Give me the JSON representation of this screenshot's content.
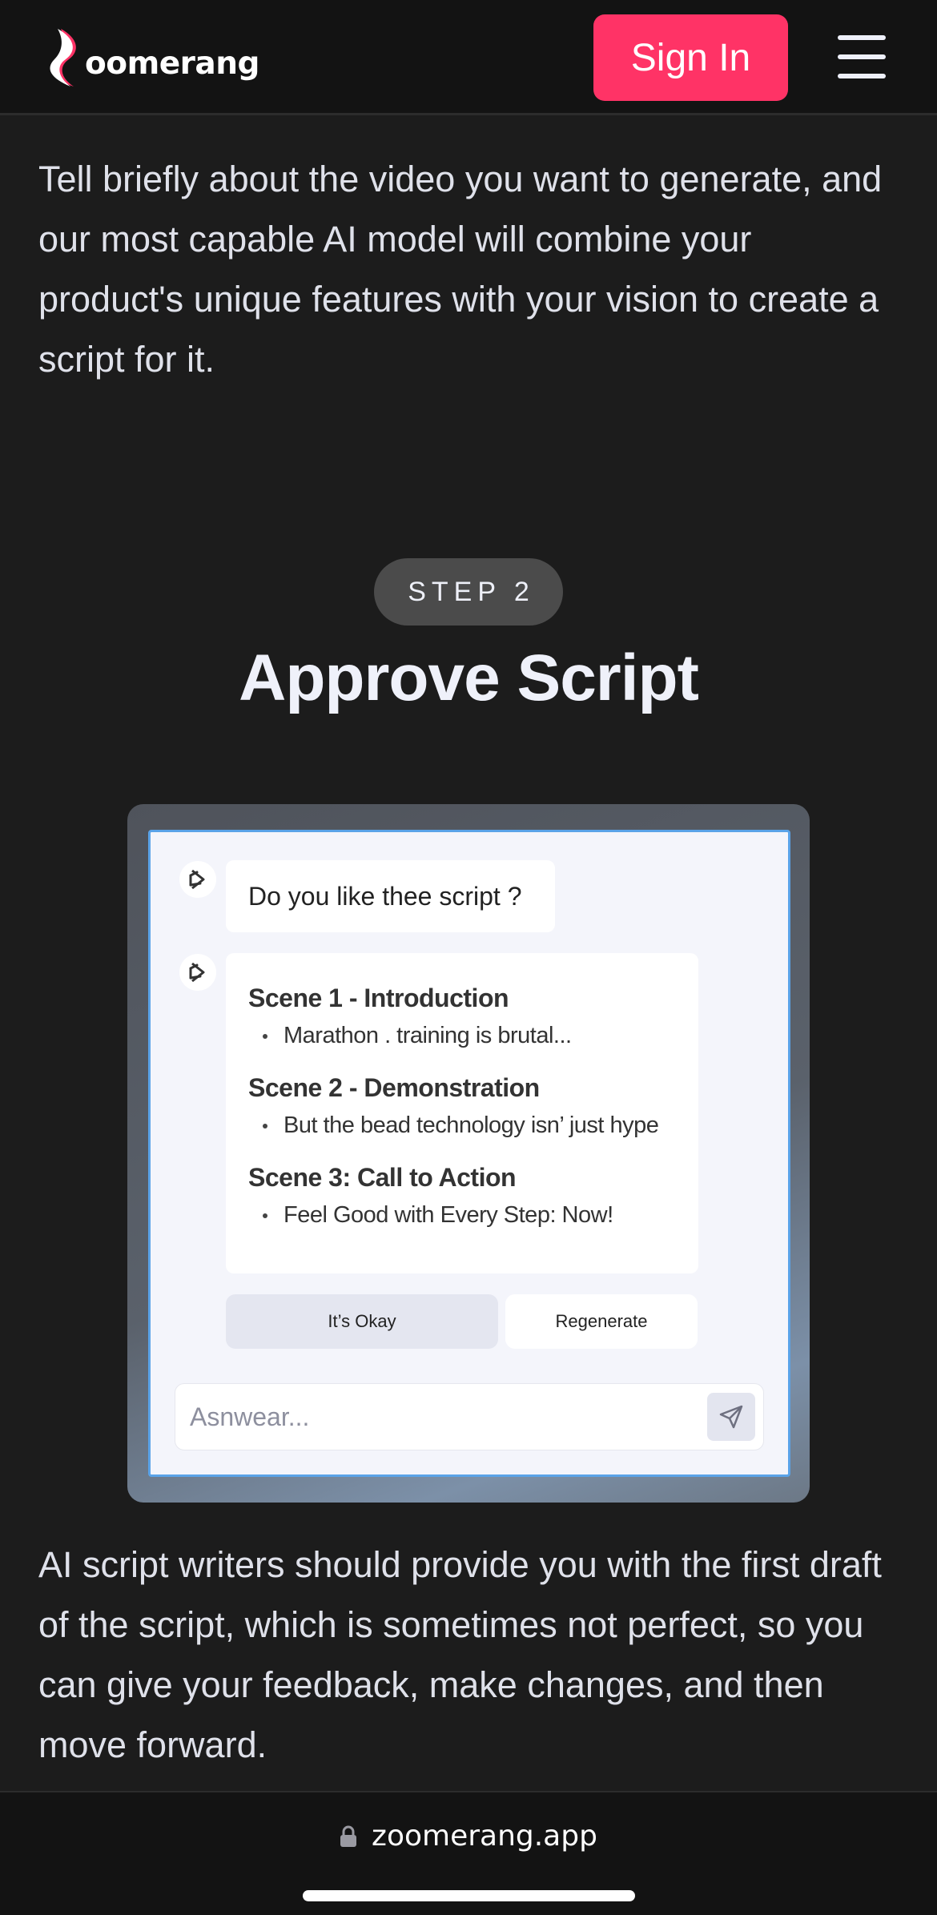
{
  "header": {
    "logo_text": "oomerang",
    "logo_icon": "boomerang-icon",
    "sign_in_label": "Sign In",
    "menu_icon": "hamburger-menu-icon",
    "accent_color": "#ff3366"
  },
  "intro": {
    "text": "Tell briefly about the video you want to generate, and our most capable AI model will combine your product's unique features with your vision to create a script for it."
  },
  "step": {
    "badge": "STEP 2",
    "title": "Approve Script"
  },
  "mockup": {
    "question": "Do you like thee script ?",
    "scenes": [
      {
        "title": "Scene 1 - Introduction",
        "item": "Marathon . training is brutal..."
      },
      {
        "title": "Scene 2 - Demonstration",
        "item": "But the bead technology isn’ just hype"
      },
      {
        "title": "Scene 3: Call to Action",
        "item": "Feel Good with Every Step: Now!"
      }
    ],
    "okay_label": "It’s Okay",
    "regenerate_label": "Regenerate",
    "answer_placeholder": "Asnwear...",
    "send_icon": "send-icon"
  },
  "description": {
    "text": "AI script writers should provide you with the first draft of the script, which is sometimes not perfect, so you can give your feedback, make changes, and then move forward."
  },
  "browser": {
    "url": "zoomerang.app",
    "lock_icon": "lock-icon"
  }
}
